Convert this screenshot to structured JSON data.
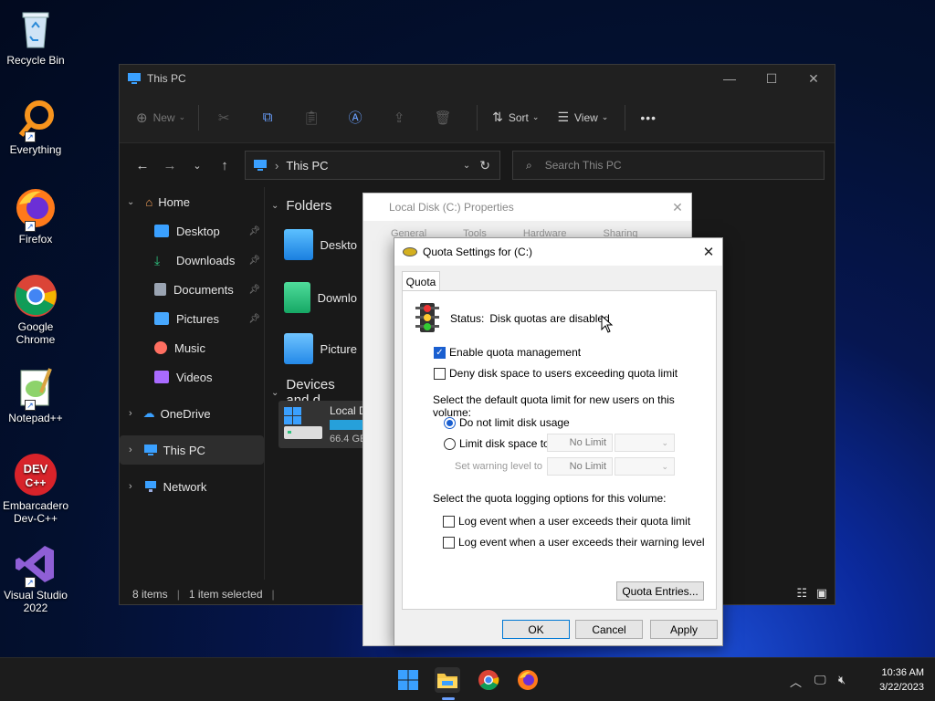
{
  "desktop": {
    "icons": [
      {
        "label": "Recycle Bin",
        "icon": "recycle-bin-icon"
      },
      {
        "label": "Everything",
        "icon": "everything-search-icon"
      },
      {
        "label": "Firefox",
        "icon": "firefox-icon"
      },
      {
        "label": "Google Chrome",
        "icon": "chrome-icon"
      },
      {
        "label": "Notepad++",
        "icon": "notepadpp-icon"
      },
      {
        "label": "Embarcadero Dev-C++",
        "icon": "devcpp-icon"
      },
      {
        "label": "Visual Studio 2022",
        "icon": "visual-studio-icon"
      }
    ]
  },
  "explorer": {
    "title": "This PC",
    "toolbar": {
      "new_label": "New",
      "sort_label": "Sort",
      "view_label": "View",
      "more_label": "•••"
    },
    "address": {
      "crumb": "This PC"
    },
    "search": {
      "placeholder": "Search This PC"
    },
    "sidebar": {
      "home": "Home",
      "items": [
        {
          "label": "Desktop",
          "color": "#3aa0ff"
        },
        {
          "label": "Downloads",
          "color": "#2ec27e"
        },
        {
          "label": "Documents",
          "color": "#9aa4b2"
        },
        {
          "label": "Pictures",
          "color": "#47a8ff"
        },
        {
          "label": "Music",
          "color": "#ff6f61"
        },
        {
          "label": "Videos",
          "color": "#a96bff"
        }
      ],
      "onedrive": "OneDrive",
      "thispc": "This PC",
      "network": "Network"
    },
    "content": {
      "folders_header": "Folders",
      "folders": [
        "Deskto",
        "Downlo",
        "Picture"
      ],
      "devices_header": "Devices and d",
      "drive_name": "Local D",
      "drive_size": "66.4 GE"
    },
    "status": {
      "items": "8 items",
      "selected": "1 item selected"
    }
  },
  "properties": {
    "title": "Local Disk (C:) Properties",
    "tabs": [
      "General",
      "Tools",
      "Hardware",
      "Sharing"
    ]
  },
  "quota": {
    "title": "Quota Settings for  (C:)",
    "tab": "Quota",
    "status_label": "Status:",
    "status_value": "Disk quotas are disabled",
    "enable_label": "Enable quota management",
    "deny_label": "Deny disk space to users exceeding quota limit",
    "default_limit_heading": "Select the default quota limit for new users on this volume:",
    "no_limit_label": "Do not limit disk usage",
    "limit_label": "Limit disk space to",
    "limit_value": "No Limit",
    "warning_label": "Set warning level to",
    "warning_value": "No Limit",
    "logging_heading": "Select the quota logging options for this volume:",
    "log_limit_label": "Log event when a user exceeds their quota limit",
    "log_warning_label": "Log event when a user exceeds their warning level",
    "entries_button": "Quota Entries...",
    "ok_button": "OK",
    "cancel_button": "Cancel",
    "apply_button": "Apply"
  },
  "taskbar": {
    "time": "10:36 AM",
    "date": "3/22/2023"
  }
}
